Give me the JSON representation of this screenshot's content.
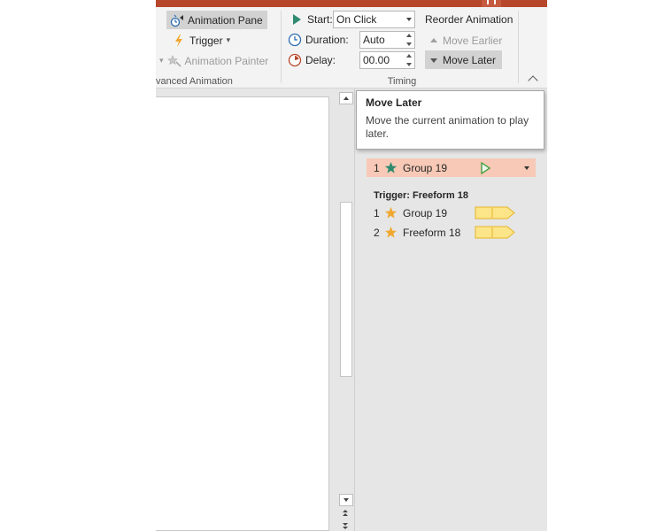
{
  "ribbon": {
    "advanced_animation": {
      "group_label": "vanced Animation",
      "animation_pane": "Animation Pane",
      "trigger": "Trigger",
      "trigger_caret": "▾",
      "animation_painter": "Animation Painter"
    },
    "timing": {
      "group_label": "Timing",
      "start_label": "Start:",
      "start_value": "On Click",
      "duration_label": "Duration:",
      "duration_value": "Auto",
      "delay_label": "Delay:",
      "delay_value": "00.00",
      "reorder_label": "Reorder Animation",
      "move_earlier": "Move Earlier",
      "move_later": "Move Later"
    }
  },
  "tooltip": {
    "title": "Move Later",
    "body": "Move the current animation to play later."
  },
  "animation_pane": {
    "selected_item": {
      "number": "1",
      "name": "Group 19"
    },
    "trigger_heading": "Trigger: Freeform 18",
    "trigger_items": [
      {
        "number": "1",
        "name": "Group 19"
      },
      {
        "number": "2",
        "name": "Freeform 18"
      }
    ]
  },
  "colors": {
    "titlebar": "#b7472a",
    "selection": "#f7c9b6",
    "star_selected": "#2e8b6f",
    "star_trigger": "#f0a830",
    "timeline_fill": "#fce589",
    "timeline_stroke": "#e6b428"
  }
}
